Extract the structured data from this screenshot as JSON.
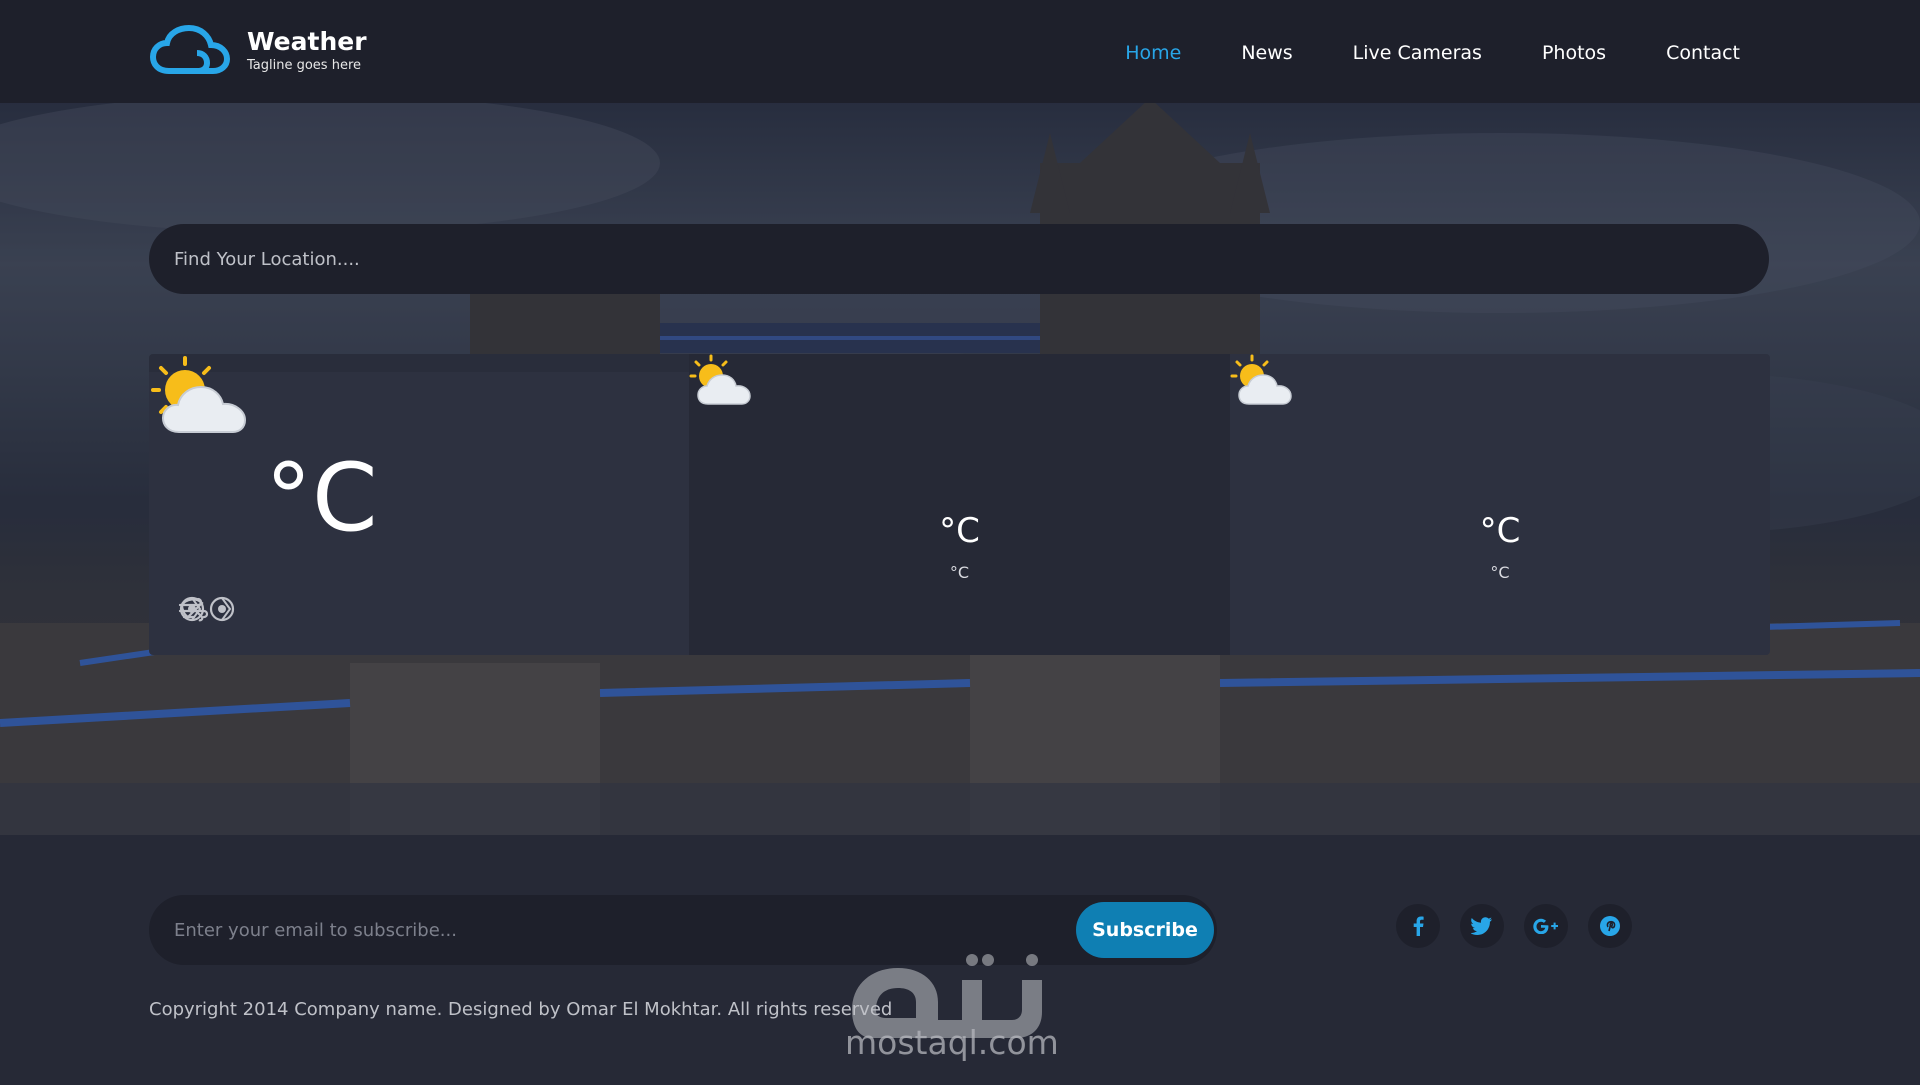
{
  "brand": {
    "name": "Weather",
    "tagline": "Tagline goes here",
    "logo_icon": "cloud-icon"
  },
  "nav": {
    "items": [
      {
        "label": "Home",
        "active": true
      },
      {
        "label": "News",
        "active": false
      },
      {
        "label": "Live Cameras",
        "active": false
      },
      {
        "label": "Photos",
        "active": false
      },
      {
        "label": "Contact",
        "active": false
      }
    ]
  },
  "search": {
    "placeholder": "Find Your Location...."
  },
  "today": {
    "temp_unit": "°C",
    "icon": "partly-cloudy-icon",
    "stats_icons": [
      "umbrella-icon",
      "wind-icon",
      "compass-icon"
    ]
  },
  "forecast": [
    {
      "icon": "partly-cloudy-icon",
      "temp": "°C",
      "sub": "°C"
    },
    {
      "icon": "partly-cloudy-icon",
      "temp": "°C",
      "sub": "°C"
    }
  ],
  "footer": {
    "subscribe_placeholder": "Enter your email to subscribe...",
    "subscribe_label": "Subscribe",
    "socials": [
      {
        "name": "facebook-icon",
        "glyph": "f"
      },
      {
        "name": "twitter-icon",
        "glyph": "🐦"
      },
      {
        "name": "google-plus-icon",
        "glyph": "G+"
      },
      {
        "name": "pinterest-icon",
        "glyph": "P"
      }
    ],
    "copyright": "Copyright 2014 Company name. Designed by Omar El Mokhtar. All rights reserved"
  },
  "watermark": {
    "text": "mostaql.com",
    "logo_text": "مستقل"
  },
  "colors": {
    "accent": "#28a6e8",
    "header_bg": "#1e202b",
    "card_bg": "#2d3140",
    "button_bg": "#0f7fb3"
  }
}
